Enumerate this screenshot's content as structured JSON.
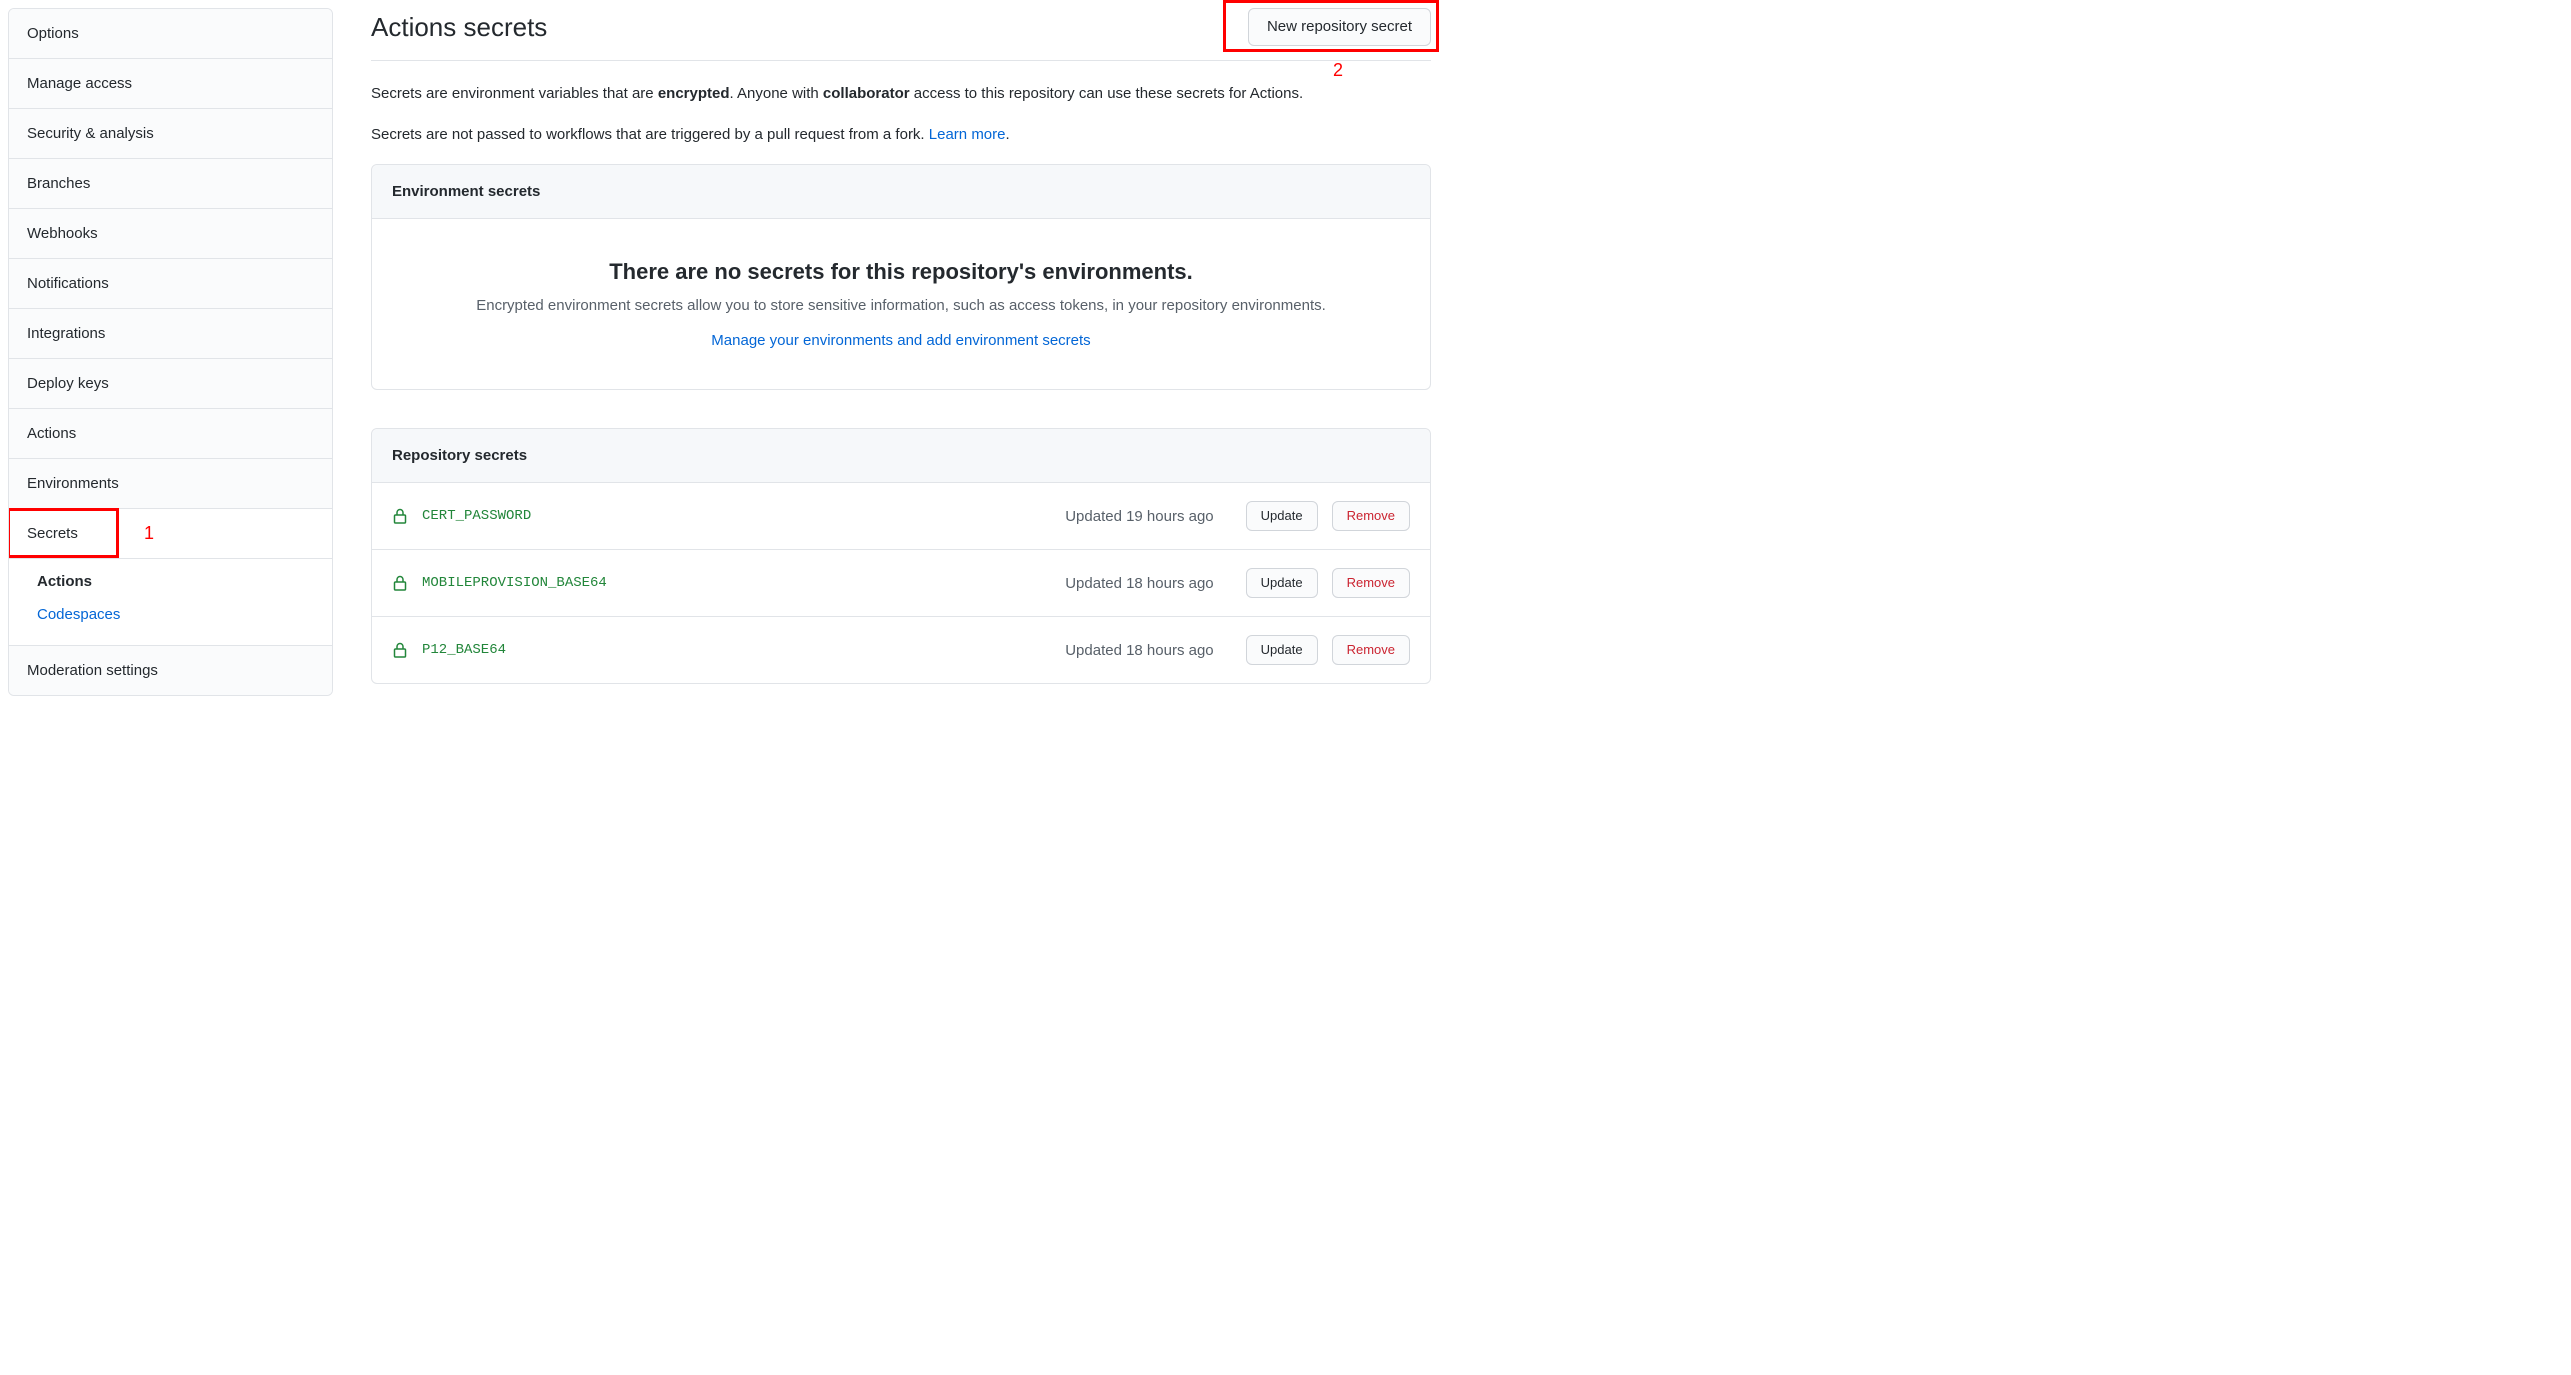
{
  "sidebar": {
    "items": [
      {
        "label": "Options",
        "key": "options"
      },
      {
        "label": "Manage access",
        "key": "manage-access"
      },
      {
        "label": "Security & analysis",
        "key": "security-analysis"
      },
      {
        "label": "Branches",
        "key": "branches"
      },
      {
        "label": "Webhooks",
        "key": "webhooks"
      },
      {
        "label": "Notifications",
        "key": "notifications"
      },
      {
        "label": "Integrations",
        "key": "integrations"
      },
      {
        "label": "Deploy keys",
        "key": "deploy-keys"
      },
      {
        "label": "Actions",
        "key": "actions"
      },
      {
        "label": "Environments",
        "key": "environments"
      },
      {
        "label": "Secrets",
        "key": "secrets",
        "selected": true
      },
      {
        "label": "Moderation settings",
        "key": "moderation-settings"
      }
    ],
    "secrets_sub": [
      {
        "label": "Actions",
        "bold": true
      },
      {
        "label": "Codespaces",
        "link": true
      }
    ]
  },
  "header": {
    "title": "Actions secrets",
    "new_btn": "New repository secret"
  },
  "intro": {
    "line1_pre": "Secrets are environment variables that are ",
    "line1_bold1": "encrypted",
    "line1_mid": ". Anyone with ",
    "line1_bold2": "collaborator",
    "line1_post": " access to this repository can use these secrets for Actions.",
    "line2_pre": "Secrets are not passed to workflows that are triggered by a pull request from a fork. ",
    "line2_link": "Learn more",
    "line2_post": "."
  },
  "env_box": {
    "title": "Environment secrets",
    "empty_title": "There are no secrets for this repository's environments.",
    "empty_desc": "Encrypted environment secrets allow you to store sensitive information, such as access tokens, in your repository environments.",
    "empty_link": "Manage your environments and add environment secrets"
  },
  "repo_box": {
    "title": "Repository secrets",
    "update_label": "Update",
    "remove_label": "Remove",
    "rows": [
      {
        "name": "CERT_PASSWORD",
        "updated": "Updated 19 hours ago"
      },
      {
        "name": "MOBILEPROVISION_BASE64",
        "updated": "Updated 18 hours ago"
      },
      {
        "name": "P12_BASE64",
        "updated": "Updated 18 hours ago"
      }
    ]
  },
  "annotations": {
    "a1": "1",
    "a2": "2"
  },
  "icons": {
    "lock_color": "#22863a"
  }
}
